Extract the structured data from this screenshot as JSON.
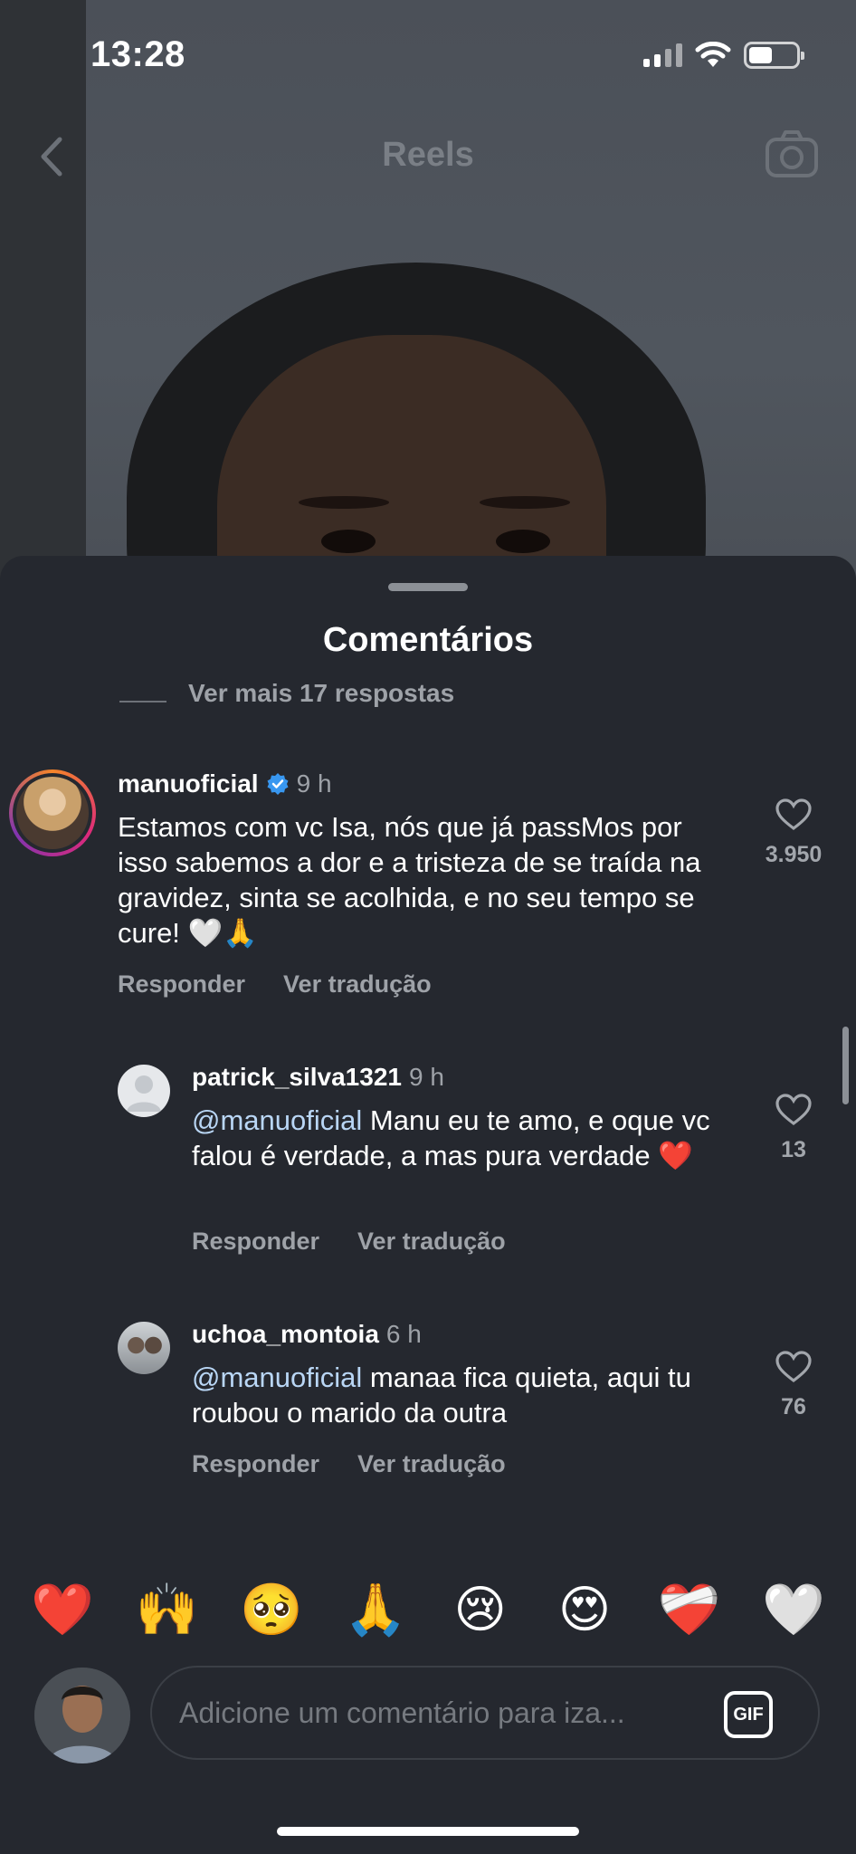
{
  "status_bar": {
    "time": "13:28"
  },
  "nav": {
    "title": "Reels"
  },
  "sheet": {
    "title": "Comentários",
    "more_replies": "Ver mais 17 respostas"
  },
  "comments": [
    {
      "username": "manuoficial",
      "verified": true,
      "time": "9 h",
      "text": "Estamos com vc Isa, nós que já passMos por isso sabemos a dor e a tristeza de se traída na gravidez, sinta se acolhida, e no seu tempo se cure! 🤍🙏",
      "reply_label": "Responder",
      "translate_label": "Ver tradução",
      "likes": "3.950"
    },
    {
      "username": "patrick_silva1321",
      "time": "9 h",
      "mention": "@manuoficial",
      "text": " Manu eu te amo, e oque vc falou é verdade, a mas pura verdade ❤️",
      "reply_label": "Responder",
      "translate_label": "Ver tradução",
      "likes": "13"
    },
    {
      "username": "uchoa_montoia",
      "time": "6 h",
      "mention": "@manuoficial",
      "text": " manaa fica quieta, aqui tu roubou o marido da outra",
      "reply_label": "Responder",
      "translate_label": "Ver tradução",
      "likes": "76"
    }
  ],
  "emoji_bar": [
    "❤️",
    "🙌",
    "🥺",
    "🙏",
    "😢",
    "😍",
    "❤️‍🩹",
    "🤍"
  ],
  "composer": {
    "placeholder": "Adicione um comentário para iza...",
    "gif_label": "GIF"
  },
  "icons": [
    "back-chevron-icon",
    "camera-icon",
    "verified-badge-icon",
    "heart-outline-icon",
    "gif-icon"
  ],
  "colors": {
    "sheet_bg": "#25282f",
    "mention": "#b9d6f5",
    "verified": "#3897f0",
    "muted_text": "#9ea2a8"
  }
}
